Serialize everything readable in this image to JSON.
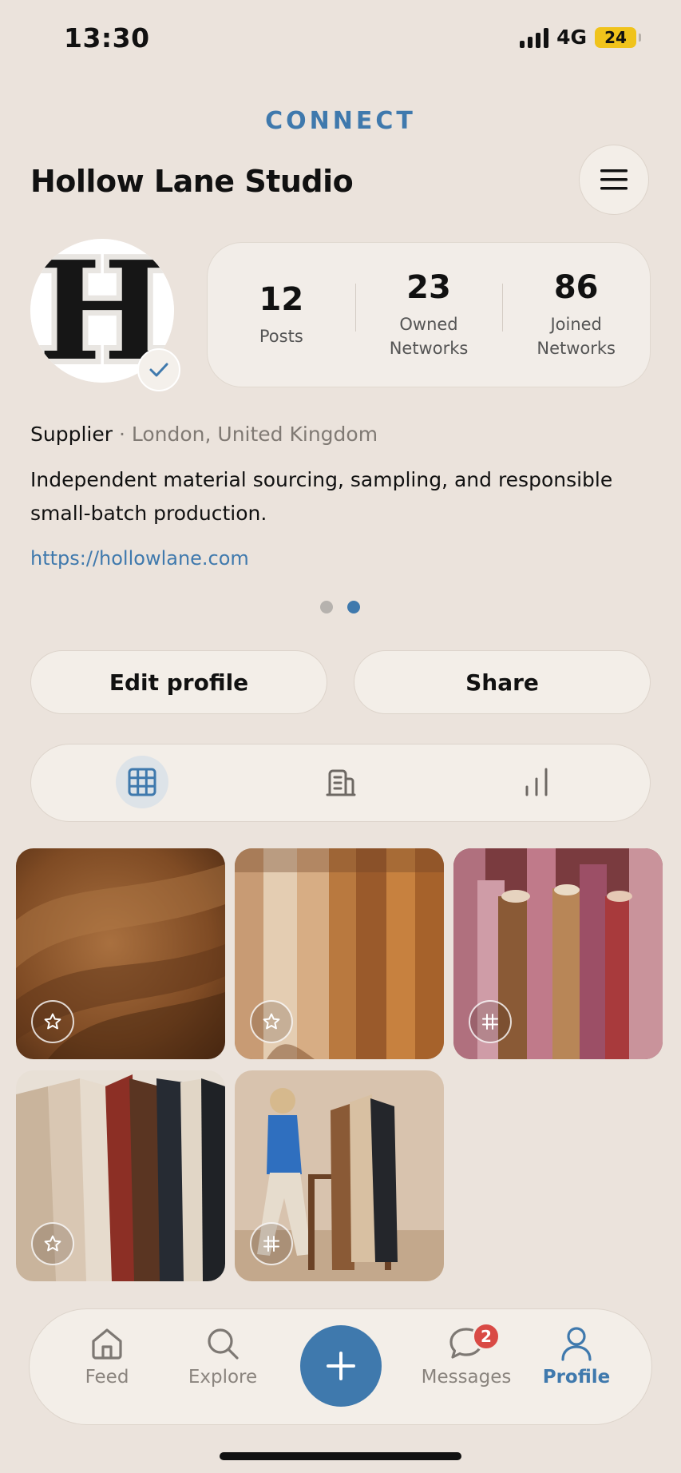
{
  "status": {
    "time": "13:30",
    "network": "4G",
    "battery": "24"
  },
  "brand": "CONNECT",
  "profile": {
    "name": "Hollow Lane Studio",
    "avatar_letter": "H",
    "category": "Supplier",
    "separator": " · ",
    "location": "London, United Kingdom",
    "bio": "Independent material sourcing, sampling, and responsible small-batch production.",
    "website": "https://hollowlane.com"
  },
  "stats": [
    {
      "value": "12",
      "label": "Posts"
    },
    {
      "value": "23",
      "label": "Owned Networks"
    },
    {
      "value": "86",
      "label": "Joined Networks"
    }
  ],
  "pager": {
    "pages": 2,
    "active": 2
  },
  "actions": {
    "edit": "Edit profile",
    "share": "Share"
  },
  "content_tabs": [
    "grid-icon",
    "building-icon",
    "bar-chart-icon"
  ],
  "content_tabs_active": "grid-icon",
  "posts": [
    {
      "image": "brown leather close-up",
      "badge": "star-icon"
    },
    {
      "image": "tan leather hides hanging",
      "badge": "star-icon"
    },
    {
      "image": "leather rolls",
      "badge": "hash-icon"
    },
    {
      "image": "coloured leather hides",
      "badge": "star-icon"
    },
    {
      "image": "woman walking by leather rack",
      "badge": "hash-icon"
    }
  ],
  "nav": {
    "feed": "Feed",
    "explore": "Explore",
    "messages": "Messages",
    "messages_badge": "2",
    "profile": "Profile",
    "active": "Profile"
  },
  "colors": {
    "accent": "#3f79ad",
    "background": "#ebe3dc",
    "badge": "#d94a45",
    "battery": "#f0c31b"
  }
}
